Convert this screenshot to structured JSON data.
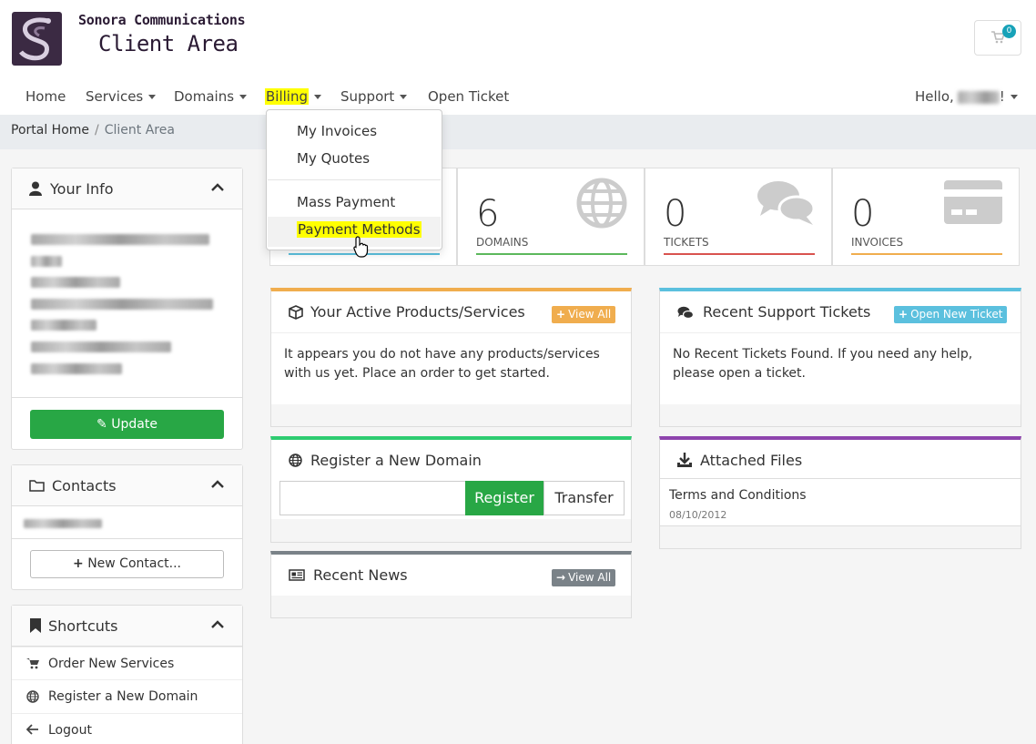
{
  "brand": {
    "line1": "Sonora Communications",
    "line2": "Client Area"
  },
  "cart": {
    "count": "0"
  },
  "nav": {
    "home": "Home",
    "services": "Services",
    "domains": "Domains",
    "billing": "Billing",
    "support": "Support",
    "open_ticket": "Open Ticket",
    "hello": "Hello,",
    "hello_suffix": "!"
  },
  "billing_menu": {
    "items": [
      "My Invoices",
      "My Quotes",
      "Mass Payment",
      "Payment Methods"
    ],
    "highlighted": "Payment Methods"
  },
  "breadcrumb": {
    "home": "Portal Home",
    "sep": "/",
    "current": "Client Area"
  },
  "your_info": {
    "title": "Your Info",
    "update_label": "Update"
  },
  "contacts": {
    "title": "Contacts",
    "new_contact_label": "New Contact..."
  },
  "shortcuts": {
    "title": "Shortcuts",
    "items": [
      "Order New Services",
      "Register a New Domain",
      "Logout"
    ]
  },
  "stats": [
    {
      "value": "6",
      "label": "DOMAINS",
      "color": "#5cb85c"
    },
    {
      "value": "0",
      "label": "TICKETS",
      "color": "#d9534f"
    },
    {
      "value": "0",
      "label": "INVOICES",
      "color": "#f0ad4e"
    }
  ],
  "services_card": {
    "title": "Your Active Products/Services",
    "view_all": "View All",
    "body": "It appears you do not have any products/services with us yet. Place an order to get started.",
    "accent": "#f0ad4e"
  },
  "tickets_card": {
    "title": "Recent Support Tickets",
    "open_new": "Open New Ticket",
    "body": "No Recent Tickets Found. If you need any help, please open a ticket.",
    "accent": "#5bc0de"
  },
  "domain_card": {
    "title": "Register a New Domain",
    "register": "Register",
    "transfer": "Transfer",
    "accent": "#2ecc71"
  },
  "files_card": {
    "title": "Attached Files",
    "file_name": "Terms and Conditions",
    "file_date": "08/10/2012",
    "accent": "#8e44ad"
  },
  "news_card": {
    "title": "Recent News",
    "view_all": "View All",
    "accent": "#7a8288"
  }
}
